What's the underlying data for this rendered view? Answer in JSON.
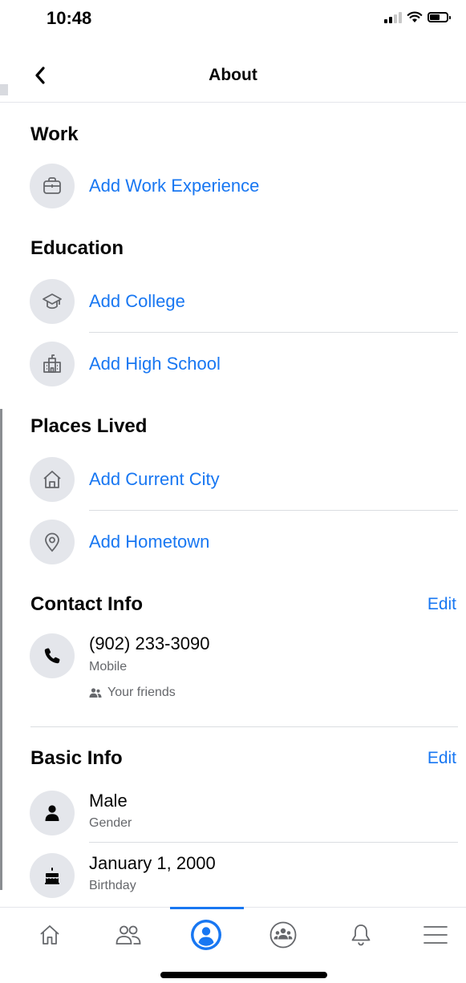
{
  "status": {
    "time": "10:48"
  },
  "header": {
    "title": "About"
  },
  "sections": {
    "work": {
      "title": "Work",
      "items": [
        {
          "label": "Add Work Experience",
          "icon": "briefcase-icon"
        }
      ]
    },
    "education": {
      "title": "Education",
      "items": [
        {
          "label": "Add College",
          "icon": "graduation-cap-icon"
        },
        {
          "label": "Add High School",
          "icon": "school-building-icon"
        }
      ]
    },
    "places": {
      "title": "Places Lived",
      "items": [
        {
          "label": "Add Current City",
          "icon": "house-icon"
        },
        {
          "label": "Add Hometown",
          "icon": "location-pin-icon"
        }
      ]
    },
    "contact": {
      "title": "Contact Info",
      "edit_label": "Edit",
      "phone": {
        "value": "(902) 233-3090",
        "type": "Mobile",
        "audience": "Your friends",
        "icon": "phone-icon"
      }
    },
    "basic": {
      "title": "Basic Info",
      "edit_label": "Edit",
      "gender": {
        "value": "Male",
        "label": "Gender",
        "icon": "person-icon"
      },
      "birthday": {
        "value": "January 1, 2000",
        "label": "Birthday",
        "icon": "cake-icon"
      }
    }
  },
  "nav": {
    "items": [
      "home-icon",
      "friends-icon",
      "profile-icon",
      "groups-icon",
      "notifications-icon",
      "menu-icon"
    ],
    "active": "profile",
    "accent": "#1877f2"
  },
  "colors": {
    "link": "#1877f2",
    "text": "#050505",
    "secondary": "#65676b",
    "icon_bg": "#e4e6eb"
  }
}
